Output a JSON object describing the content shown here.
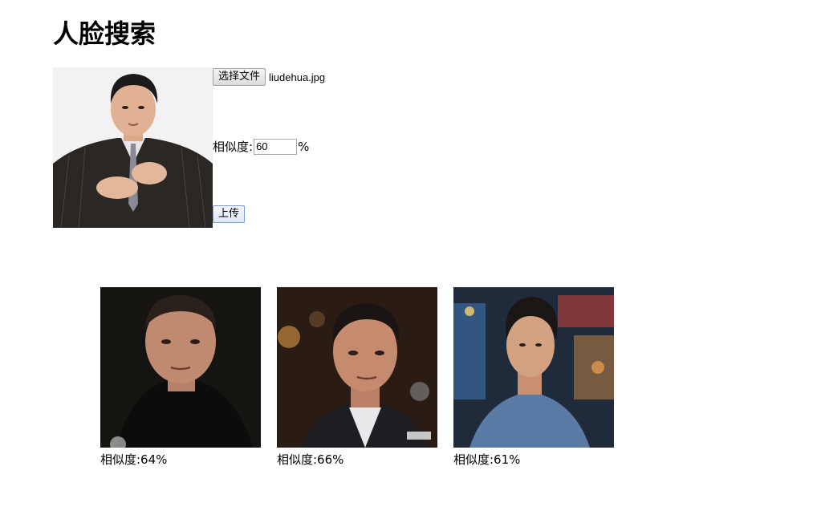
{
  "page": {
    "title": "人脸搜索"
  },
  "query": {
    "file_button_label": "选择文件",
    "file_name": "liudehua.jpg",
    "similarity_label": "相似度:",
    "similarity_value": "60",
    "similarity_unit": "%",
    "upload_button_label": "上传"
  },
  "results": [
    {
      "similarity_text": "相似度:64%"
    },
    {
      "similarity_text": "相似度:66%"
    },
    {
      "similarity_text": "相似度:61%"
    }
  ]
}
